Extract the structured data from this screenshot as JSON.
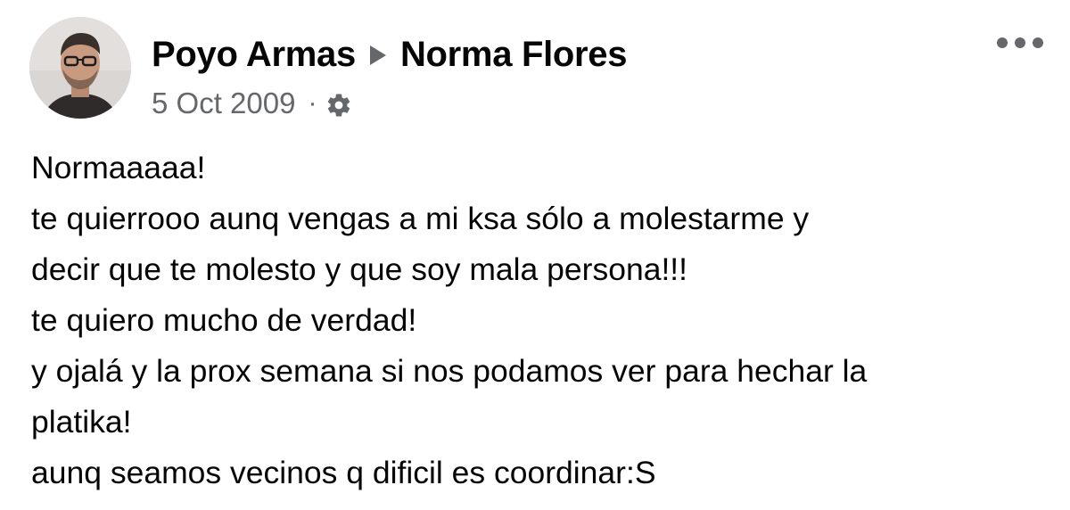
{
  "post": {
    "author": "Poyo Armas",
    "recipient": "Norma Flores",
    "date": "5 Oct 2009",
    "separator": "·",
    "privacy_icon": "gear-icon",
    "more_icon": "more-options-icon",
    "lines": [
      "Normaaaaa!",
      "te quierrooo aunq vengas a mi ksa sólo a molestarme y",
      "decir que te molesto y que soy mala persona!!!",
      "te quiero mucho de verdad!",
      "y ojalá y la prox semana si nos podamos ver para hechar la",
      "platika!",
      "aunq seamos vecinos q dificil es coordinar:S"
    ]
  },
  "colors": {
    "text": "#050505",
    "secondary": "#65676b",
    "background": "#ffffff"
  }
}
